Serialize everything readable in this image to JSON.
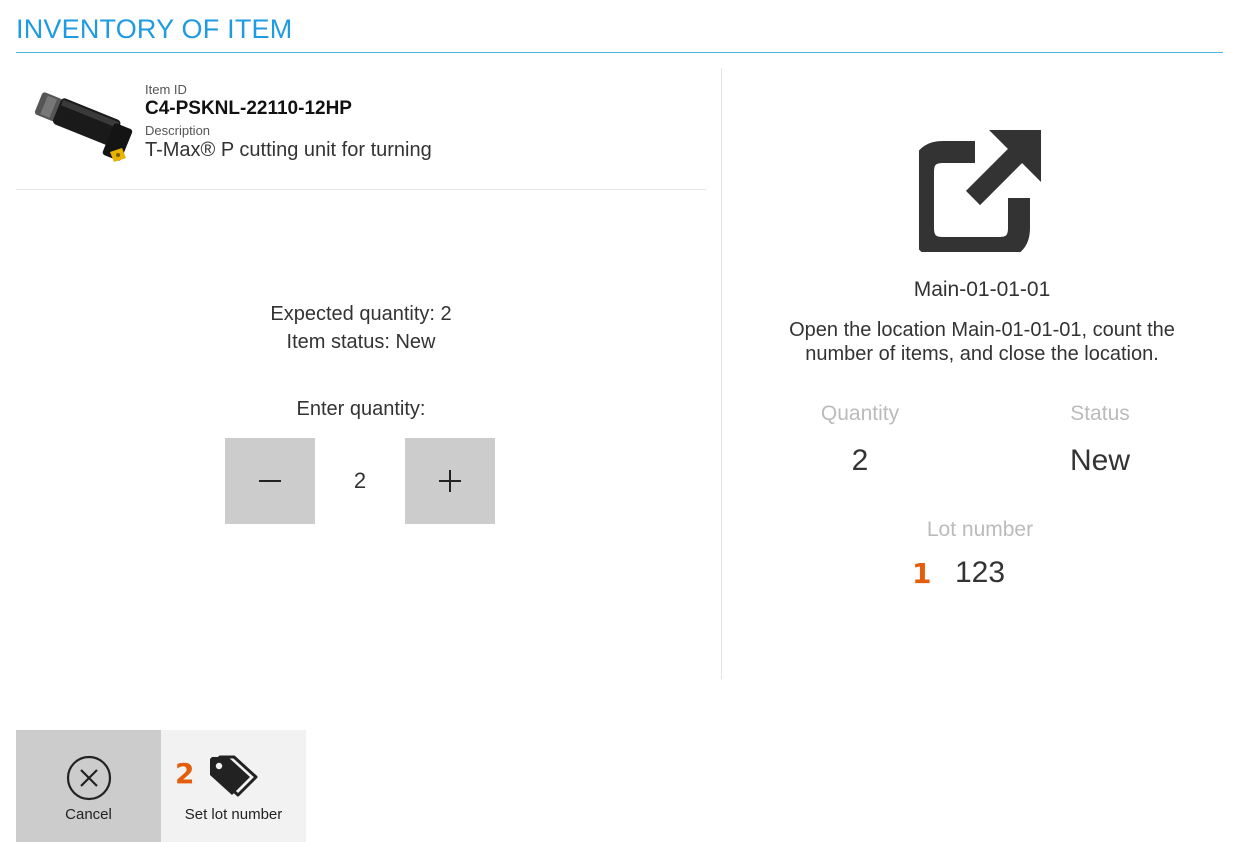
{
  "header": {
    "title": "INVENTORY OF ITEM"
  },
  "item": {
    "id_label": "Item ID",
    "id": "C4-PSKNL-22110-12HP",
    "description_label": "Description",
    "description": "T-Max® P cutting unit for turning",
    "image_icon": "cutting-tool-image"
  },
  "counting": {
    "expected_quantity": "Expected quantity: 2",
    "item_status": "Item status: New",
    "enter_label": "Enter quantity:",
    "value": "2",
    "minus_icon": "minus-icon",
    "plus_icon": "plus-icon"
  },
  "location": {
    "icon": "open-external-icon",
    "name": "Main-01-01-01",
    "instruction": "Open the location Main-01-01-01, count the number of items, and close the location.",
    "quantity_label": "Quantity",
    "quantity_value": "2",
    "status_label": "Status",
    "status_value": "New",
    "lot_label": "Lot number",
    "lot_value": "123"
  },
  "annotations": {
    "marker1": "1",
    "marker2": "2"
  },
  "actions": {
    "cancel_label": "Cancel",
    "cancel_icon": "cancel-circle-icon",
    "set_lot_label": "Set lot number",
    "set_lot_icon": "tags-icon"
  },
  "colors": {
    "accent": "#1f9be1",
    "header_rule": "#4fb6e6",
    "marker": "#e35d0a",
    "button_gray": "#cccccc"
  }
}
